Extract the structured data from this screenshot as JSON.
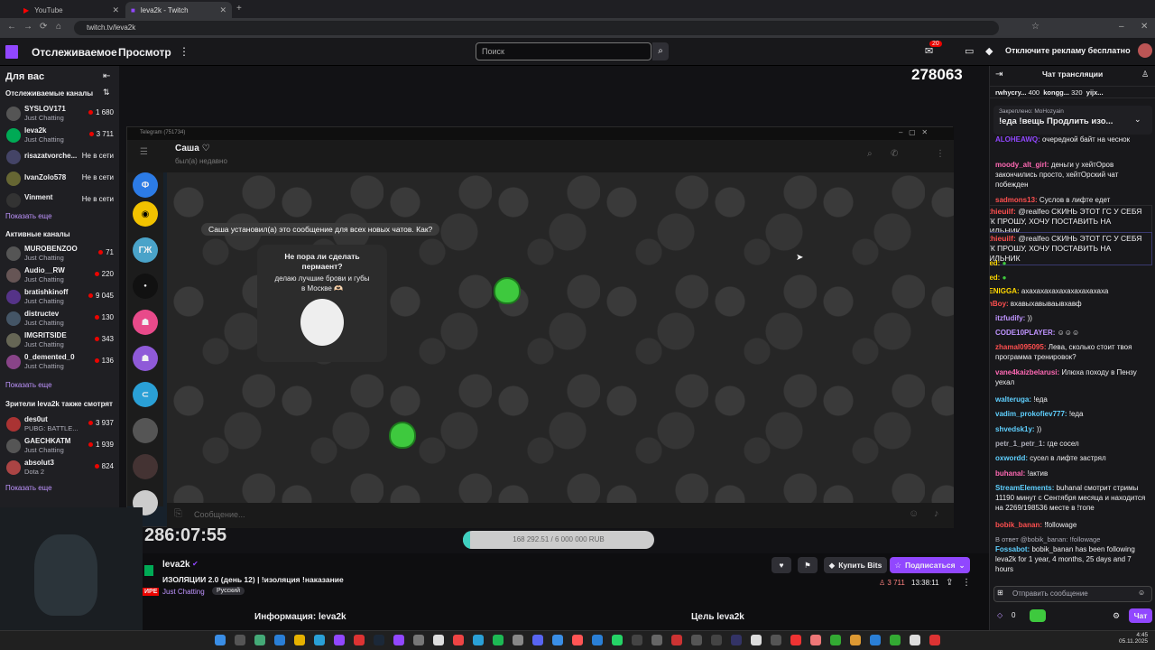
{
  "browser": {
    "tabs": [
      {
        "label": "YouTube",
        "active": false
      },
      {
        "label": "leva2k - Twitch",
        "active": true
      }
    ],
    "url": "twitch.tv/leva2k"
  },
  "topnav": {
    "following": "Отслеживаемое",
    "browse": "Просмотр",
    "search_placeholder": "Поиск",
    "notifications_count": "20",
    "ad_free": "Отключите рекламу бесплатно"
  },
  "sidebar": {
    "for_you": "Для вас",
    "followed_header": "Отслеживаемые каналы",
    "followed": [
      {
        "name": "SYSLOV171",
        "game": "Just Chatting",
        "viewers": "1 680",
        "live": true
      },
      {
        "name": "leva2k",
        "game": "Just Chatting",
        "viewers": "3 711",
        "live": true
      },
      {
        "name": "risazatvorche...",
        "game": "",
        "viewers": "Не в сети",
        "live": false
      },
      {
        "name": "IvanZolo578",
        "game": "",
        "viewers": "Не в сети",
        "live": false
      },
      {
        "name": "Vinment",
        "game": "",
        "viewers": "Не в сети",
        "live": false
      }
    ],
    "show_more": "Показать еще",
    "active_header": "Активные каналы",
    "active": [
      {
        "name": "MUROBENZOO",
        "game": "Just Chatting",
        "viewers": "71"
      },
      {
        "name": "Audio__RW",
        "game": "Just Chatting",
        "viewers": "220"
      },
      {
        "name": "bratishkinoff",
        "game": "Just Chatting",
        "viewers": "9 045"
      },
      {
        "name": "distructev",
        "game": "Just Chatting",
        "viewers": "130"
      },
      {
        "name": "IMGRITSIDE",
        "game": "Just Chatting",
        "viewers": "343"
      },
      {
        "name": "0_demented_0",
        "game": "Just Chatting",
        "viewers": "136"
      }
    ],
    "also_header": "Зрители leva2k также смотрят",
    "also": [
      {
        "name": "des0ut",
        "game": "PUBG: BATTLE...",
        "viewers": "3 937"
      },
      {
        "name": "GAECHKATM",
        "game": "Just Chatting",
        "viewers": "1 939"
      },
      {
        "name": "absolut3",
        "game": "Dota 2",
        "viewers": "824"
      }
    ]
  },
  "stream": {
    "overlay_count": "278063",
    "timer": "286:07:55",
    "goal_text": "168 292.51 / 6 000 000 RUB",
    "goal_progress": 0.028
  },
  "telegram": {
    "title_bar": "Telegram (751734)",
    "contact": "Саша ♡",
    "status": "был(а) недавно",
    "system_msg": "Саша установил(а) это сообщение для всех новых чатов. Как?",
    "card_title": "Не пора ли сделать пермаент?",
    "card_body": "делаю лучшие брови и губы в Москве 🫶🏻",
    "input_placeholder": "Сообщение...",
    "folders": [
      "Ф",
      "ГЖ"
    ]
  },
  "info": {
    "channel": "leva2k",
    "title": "ИЗОЛЯЦИИ 2.0 (день 12) | !изоляция !наказание",
    "live_badge": "ИРЕ",
    "category": "Just Chatting",
    "tag": "Русский",
    "viewers": "3 711",
    "uptime": "13:38:11",
    "bits": "Купить Bits",
    "subscribe": "Подписаться",
    "about": "Информация: leva2k",
    "goal": "Цель leva2k"
  },
  "chat": {
    "header": "Чат трансляции",
    "top_gifters": [
      {
        "name": "rwhycry...",
        "value": "400"
      },
      {
        "name": "kongg...",
        "value": "320"
      },
      {
        "name": "yijx..."
      }
    ],
    "pinned_label": "Закреплено: MoHozyain",
    "pinned_text": "!еда !вещь Продлить изо...",
    "messages": [
      {
        "user": "ALOHEAWQ:",
        "text": "очередной байт на чеснок",
        "color": "#9147ff"
      },
      {
        "user": "moody_alt_girl:",
        "text": "деньги у хейтОров закончились просто, хейтОрский чат побежден",
        "color": "#ff69b4"
      },
      {
        "user": "sadmons13:",
        "text": "Суслов в лифте едет",
        "color": "#ff4f4f"
      },
      {
        "user": "matthieuilf:",
        "text": "@realfeo СКИНЬ ЭТОТ ГС У СЕБЯ В ТГК ПРОШУ, ХОЧУ ПОСТАВИТЬ НА БУДИЛЬНИК",
        "color": "#ff4f4f"
      },
      {
        "user": "matthieuilf:",
        "text": "@realfeo СКИНЬ ЭТОТ ГС У СЕБЯ В ТГК ПРОШУ, ХОЧУ ПОСТАВИТЬ НА БУДИЛЬНИК",
        "color": "#ff4f4f"
      },
      {
        "user": "dolbaed:",
        "text": "",
        "color": "#ffd700"
      },
      {
        "user": "dolbaed:",
        "text": "",
        "color": "#ffd700"
      },
      {
        "user": "WHITENIGGA:",
        "text": "ахахахахахахахахахахаха",
        "color": "#ffd700"
      },
      {
        "user": "alcashBoy:",
        "text": "вхавыхавываывхавф",
        "color": "#ff4f4f"
      },
      {
        "user": "itzfudify:",
        "text": "))",
        "color": "#bf94ff"
      },
      {
        "user": "CODE10PLAYER:",
        "text": "",
        "color": "#bf94ff"
      },
      {
        "user": "zhamal095095:",
        "text": "Лева, сколько стоит твоя программа тренировок?",
        "color": "#ff4f4f"
      },
      {
        "user": "vane4kaizbelarusi:",
        "text": "Илюха походу в Пензу уехал",
        "color": "#ff69b4"
      },
      {
        "user": "walteruga:",
        "text": "!еда",
        "color": "#5fd0ff"
      },
      {
        "user": "vadim_prokofiev777:",
        "text": "!еда",
        "color": "#5fd0ff"
      },
      {
        "user": "shvedsk1y:",
        "text": "))",
        "color": "#5fd0ff"
      },
      {
        "user": "petr_1_petr_1:",
        "text": "где сосел",
        "color": "#adadb8"
      },
      {
        "user": "oxwordd:",
        "text": "сусел в лифте застрял",
        "color": "#5fd0ff"
      },
      {
        "user": "buhanal:",
        "text": "!актив",
        "color": "#ff69b4"
      },
      {
        "user": "StreamElements:",
        "text": "buhanal смотрит стримы 11190 минут с Сентября месяца и находится на 2269/198536 месте в !топе",
        "color": "#5fd0ff"
      },
      {
        "user": "bobik_banan:",
        "text": "!followage",
        "color": "#ff4f4f"
      },
      {
        "user": "Fossabot:",
        "text": "bobik_banan has been following leva2k for 1 year, 4 months, 25 days and 7 hours",
        "color": "#5fd0ff"
      }
    ],
    "reply_to": "В ответ @bobik_banan: !followage",
    "input_placeholder": "Отправить сообщение",
    "points": "0",
    "chat_button": "Чат"
  },
  "taskbar": {
    "time": "4:45",
    "date": "05.11.2025"
  }
}
